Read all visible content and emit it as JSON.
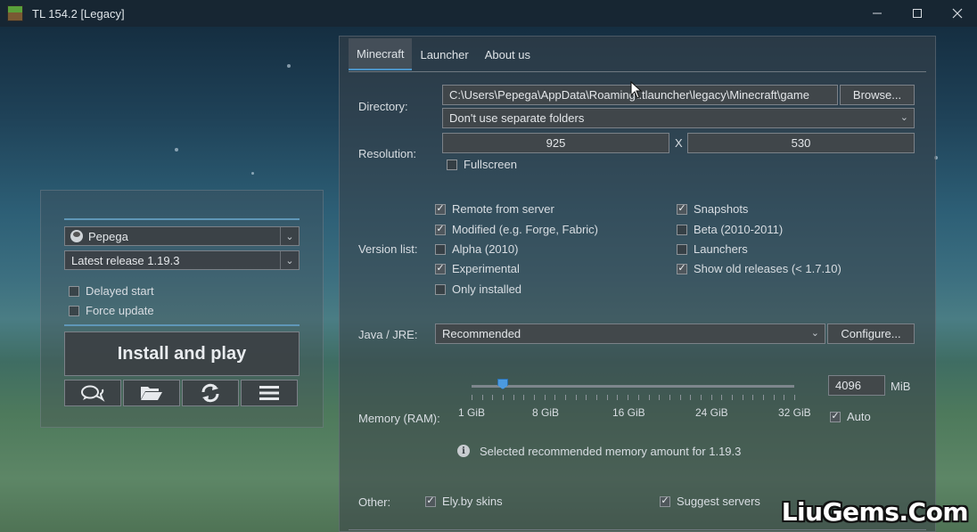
{
  "window": {
    "title": "TL 154.2 [Legacy]",
    "controls": [
      "minimize-icon",
      "maximize-icon",
      "close-icon"
    ]
  },
  "launcher": {
    "account": "Pepega",
    "version": "Latest release 1.19.3",
    "delayed_start": {
      "label": "Delayed start",
      "checked": false
    },
    "force_update": {
      "label": "Force update",
      "checked": false
    },
    "install_button": "Install and play",
    "icon_buttons": [
      "chat-icon",
      "folder-icon",
      "refresh-icon",
      "menu-icon"
    ],
    "accent_color": "#5f97b8"
  },
  "settings": {
    "tabs": [
      {
        "label": "Minecraft",
        "active": true
      },
      {
        "label": "Launcher",
        "active": false
      },
      {
        "label": "About us",
        "active": false
      }
    ],
    "directory": {
      "label": "Directory:",
      "path": "C:\\Users\\Pepega\\AppData\\Roaming\\.tlauncher\\legacy\\Minecraft\\game",
      "browse_button": "Browse...",
      "folders_option": "Don't use separate folders"
    },
    "resolution": {
      "label": "Resolution:",
      "width": "925",
      "separator": "X",
      "height": "530",
      "fullscreen": {
        "label": "Fullscreen",
        "checked": false
      }
    },
    "version_list": {
      "label": "Version list:",
      "left": [
        {
          "label": "Remote from server",
          "checked": true
        },
        {
          "label": "Modified (e.g. Forge, Fabric)",
          "checked": true
        },
        {
          "label": "Alpha (2010)",
          "checked": false
        },
        {
          "label": "Experimental",
          "checked": true
        },
        {
          "label": "Only installed",
          "checked": false
        }
      ],
      "right": [
        {
          "label": "Snapshots",
          "checked": true
        },
        {
          "label": "Beta (2010-2011)",
          "checked": false
        },
        {
          "label": "Launchers",
          "checked": false
        },
        {
          "label": "Show old releases (< 1.7.10)",
          "checked": true
        }
      ]
    },
    "java": {
      "label": "Java / JRE:",
      "value": "Recommended",
      "configure_button": "Configure..."
    },
    "memory": {
      "label": "Memory (RAM):",
      "value": "4096",
      "unit": "MiB",
      "slider_value_mib": 4096,
      "slider_min_gib": 1,
      "slider_max_gib": 32,
      "scale_labels": [
        "1 GiB",
        "8 GiB",
        "16 GiB",
        "24 GiB",
        "32 GiB"
      ],
      "auto": {
        "label": "Auto",
        "checked": true
      },
      "info": "Selected recommended memory amount for 1.19.3",
      "accent_color": "#4b9ae0"
    },
    "other": {
      "label": "Other:",
      "ely_skins": {
        "label": "Ely.by skins",
        "checked": true
      },
      "suggest_servers": {
        "label": "Suggest servers",
        "checked": true
      }
    }
  },
  "watermark": "LiuGems.Com"
}
